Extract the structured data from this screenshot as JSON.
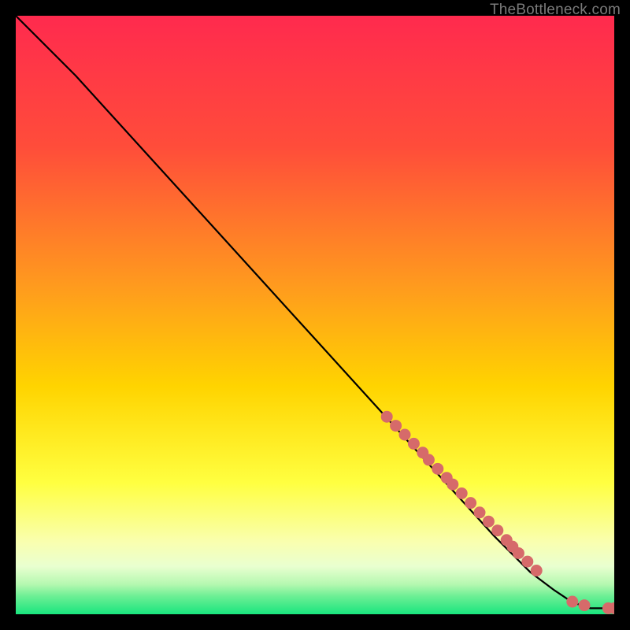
{
  "attribution": "TheBottleneck.com",
  "colors": {
    "background": "#000000",
    "gradient_top": "#ff2a4e",
    "gradient_upper": "#ff6a2f",
    "gradient_mid": "#ffd400",
    "gradient_low": "#ffff6a",
    "gradient_pale": "#f6ffd0",
    "gradient_green_light": "#8cf7a0",
    "gradient_green": "#19e57e",
    "curve": "#000000",
    "marker_fill": "#d66a6a",
    "marker_stroke": "#b84f4f"
  },
  "chart_data": {
    "type": "line",
    "title": "",
    "xlabel": "",
    "ylabel": "",
    "xlim": [
      0,
      100
    ],
    "ylim": [
      0,
      100
    ],
    "curve": {
      "x": [
        0,
        4,
        10,
        20,
        30,
        40,
        50,
        60,
        70,
        80,
        86,
        90,
        93,
        96,
        100
      ],
      "y": [
        100,
        96,
        90,
        79,
        68,
        57,
        46,
        35,
        24,
        13,
        7,
        4,
        2,
        1,
        1
      ]
    },
    "markers": {
      "x": [
        62,
        63.5,
        65,
        66.5,
        68,
        69,
        70.5,
        72,
        73,
        74.5,
        76,
        77.5,
        79,
        80.5,
        82,
        83,
        84,
        85.5,
        87,
        93,
        95,
        99,
        100
      ],
      "y": [
        33,
        31.5,
        30,
        28.5,
        27,
        25.8,
        24.3,
        22.8,
        21.7,
        20.2,
        18.6,
        17,
        15.5,
        14,
        12.4,
        11.3,
        10.2,
        8.8,
        7.3,
        2.1,
        1.5,
        1,
        1
      ]
    }
  }
}
